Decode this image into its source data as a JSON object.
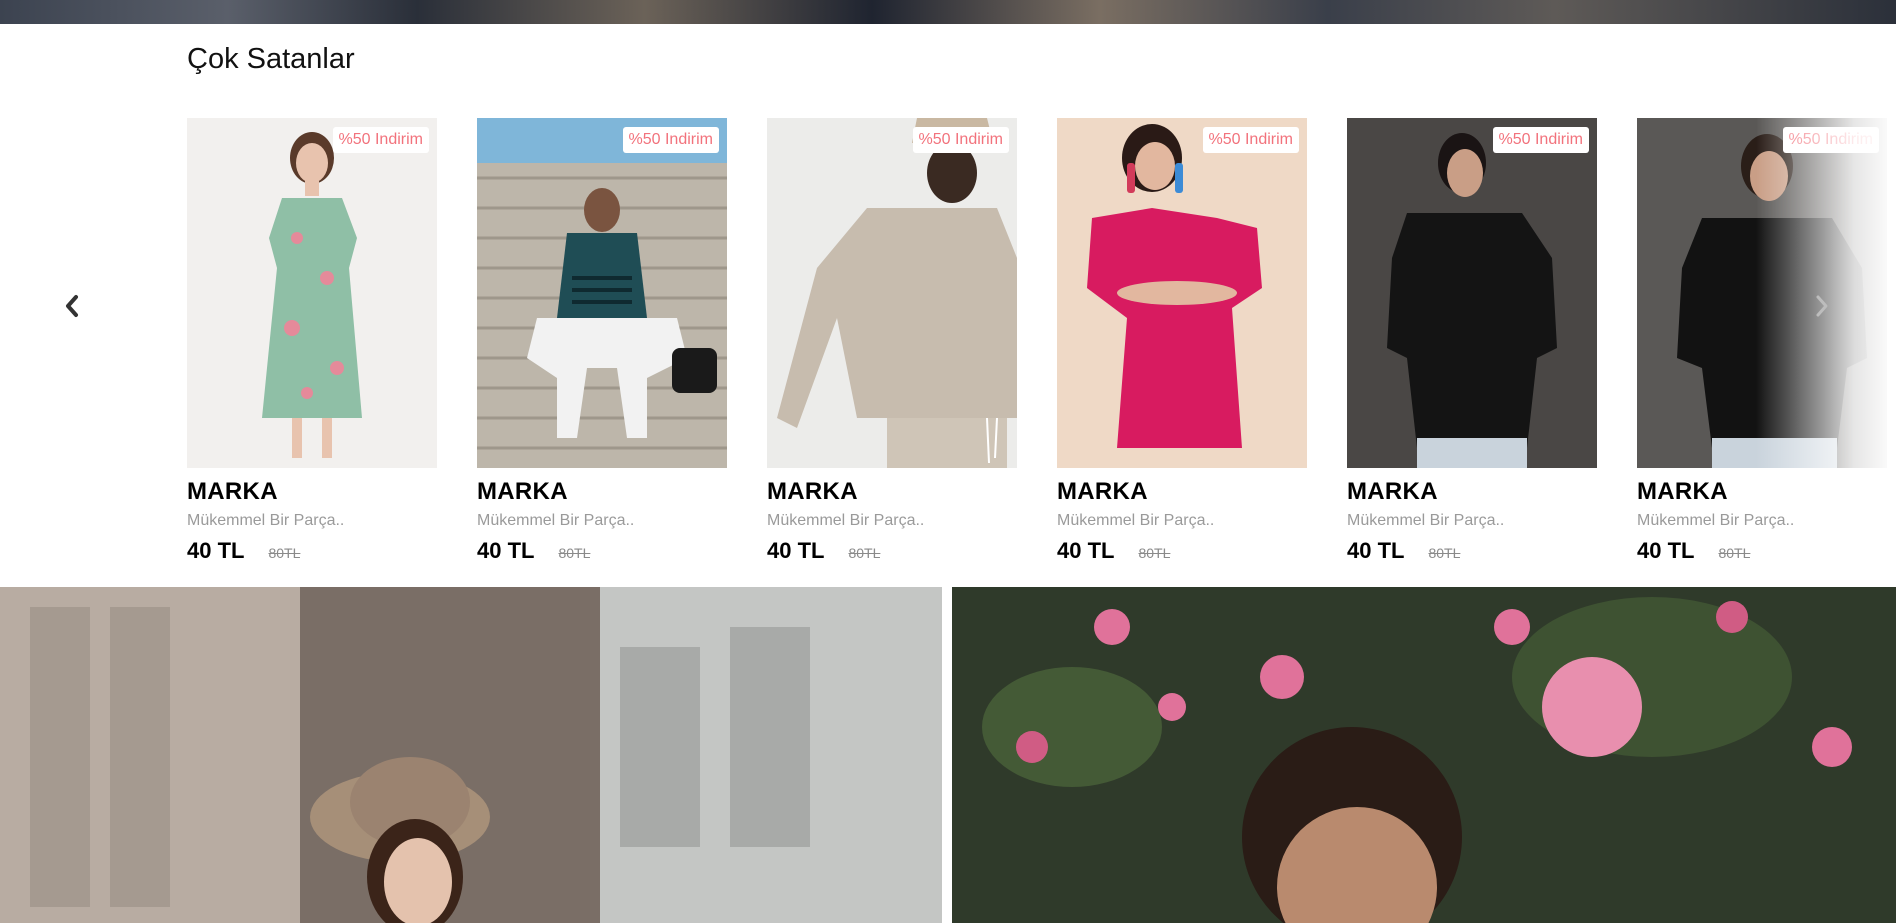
{
  "hero": {
    "image": "hero-image-strip"
  },
  "bestsellers": {
    "title": "Çok Satanlar",
    "nav": {
      "prev_icon": "chevron-left-icon",
      "next_icon": "chevron-right-icon"
    },
    "products": [
      {
        "badge": "%50 Indirim",
        "brand": "MARKA",
        "desc": "Mükemmel Bir Parça..",
        "price": "40 TL",
        "old_price": "80TL",
        "image": "woman-floral-dress-photo",
        "colors": {
          "bg": "#f2f0ee",
          "garment": "#8fbfa6",
          "accent": "#e58a9a"
        }
      },
      {
        "badge": "%50 Indirim",
        "brand": "MARKA",
        "desc": "Mükemmel Bir Parça..",
        "price": "40 TL",
        "old_price": "80TL",
        "image": "man-on-stairs-photo",
        "colors": {
          "bg": "#bdb6aa",
          "garment": "#1f4d55",
          "accent": "#f2f2f2"
        }
      },
      {
        "badge": "%50 Indirim",
        "brand": "MARKA",
        "desc": "Mükemmel Bir Parça..",
        "price": "40 TL",
        "old_price": "80TL",
        "image": "man-beige-sweatshirt-photo",
        "colors": {
          "bg": "#ececea",
          "garment": "#c7bcae",
          "accent": "#3a2a22"
        }
      },
      {
        "badge": "%50 Indirim",
        "brand": "MARKA",
        "desc": "Mükemmel Bir Parça..",
        "price": "40 TL",
        "old_price": "80TL",
        "image": "woman-pink-dress-photo",
        "colors": {
          "bg": "#efd9c6",
          "garment": "#d81b60",
          "accent": "#2a1a16"
        }
      },
      {
        "badge": "%50 Indirim",
        "brand": "MARKA",
        "desc": "Mükemmel Bir Parça..",
        "price": "40 TL",
        "old_price": "80TL",
        "image": "man-black-shirt-photo",
        "colors": {
          "bg": "#4a4745",
          "garment": "#141414",
          "accent": "#c9d3dc"
        }
      },
      {
        "badge": "%50 Indirim",
        "brand": "MARKA",
        "desc": "Mükemmel Bir Parça..",
        "price": "40 TL",
        "old_price": "80TL",
        "image": "man-black-shirt-2-photo",
        "colors": {
          "bg": "#5a5856",
          "garment": "#121212",
          "accent": "#c9d3dc"
        }
      }
    ]
  },
  "banners": [
    {
      "image": "woman-hat-street-photo",
      "colors": {
        "bg": "#7a6e66",
        "accent": "#a68f78"
      }
    },
    {
      "image": "man-flowers-photo",
      "colors": {
        "bg": "#2f3a2a",
        "accent": "#e0729a"
      }
    }
  ]
}
